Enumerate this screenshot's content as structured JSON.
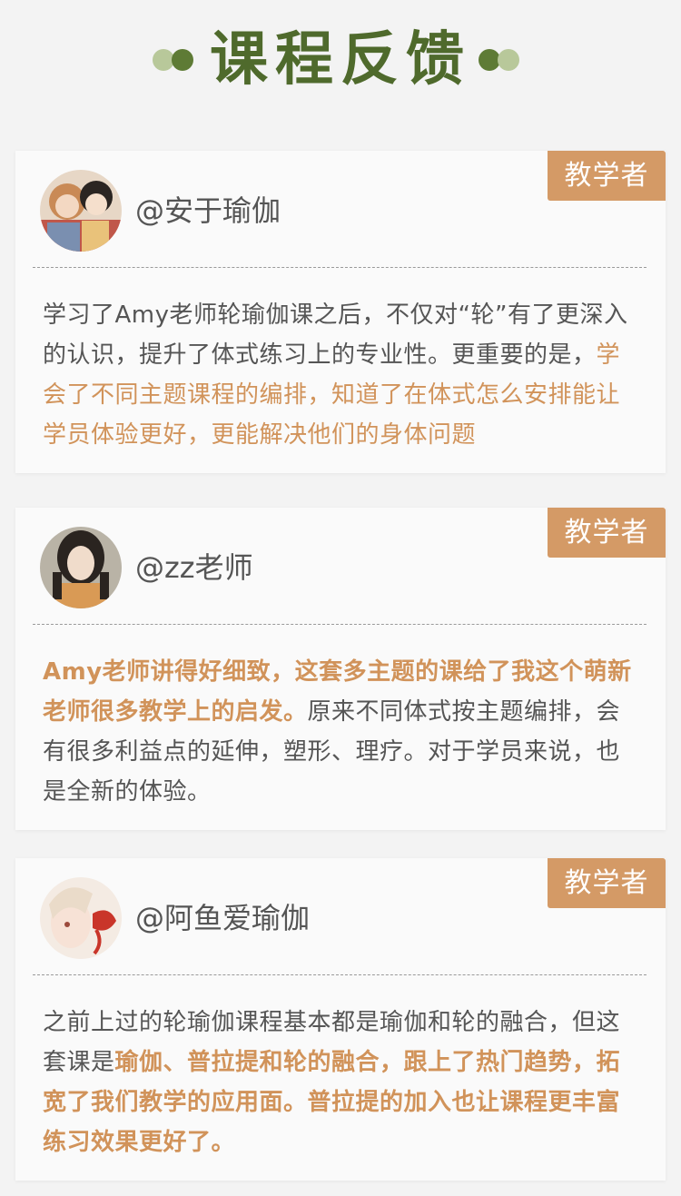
{
  "header": {
    "title": "课程反馈"
  },
  "badge_label": "教学者",
  "colors": {
    "accent": "#d49a66",
    "title_green": "#4f6a2c",
    "dot_dark": "#5e7b35",
    "dot_light": "#b8c89a"
  },
  "reviews": [
    {
      "avatar": "avatar-illustrated-girls",
      "username": "@安于瑜伽",
      "segments": [
        {
          "text": "学习了Amy老师轮瑜伽课之后，不仅对“轮”有了更深入的认识，提升了体式练习上的专业性。更重要的是，",
          "style": "normal"
        },
        {
          "text": "学会了不同主题课程的编排，知道了在体式怎么安排能让学员体验更好，更能解决他们的身体问题",
          "style": "highlight"
        }
      ]
    },
    {
      "avatar": "avatar-photo-woman",
      "username": "@zz老师",
      "segments": [
        {
          "text": "Amy老师讲得好细致，这套多主题的课给了我这个萌新老师很多教学上的启发。",
          "style": "highlight-bold"
        },
        {
          "text": "原来不同体式按主题编排，会有很多利益点的延伸，塑形、理疗。对于学员来说，也是全新的体验。",
          "style": "normal"
        }
      ]
    },
    {
      "avatar": "avatar-illustrated-fish",
      "username": "@阿鱼爱瑜伽",
      "segments": [
        {
          "text": "之前上过的轮瑜伽课程基本都是瑜伽和轮的融合，但这套课是",
          "style": "normal"
        },
        {
          "text": "瑜伽、普拉提和轮的融合，跟上了热门趋势，拓宽了我们教学的应用面。普拉提的加入也让课程更丰富练习效果更好了。",
          "style": "highlight-bold"
        }
      ]
    }
  ]
}
